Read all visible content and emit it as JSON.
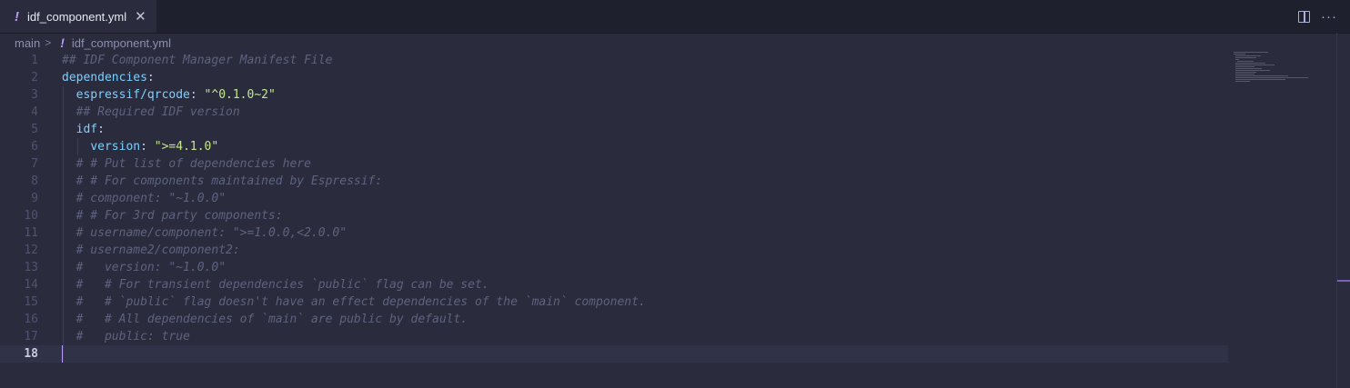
{
  "tab": {
    "label": "idf_component.yml",
    "close": "✕",
    "modified_icon": "!"
  },
  "toolbar": {
    "split_icon": "split-editor-icon",
    "more": "···"
  },
  "breadcrumb": {
    "folder": "main",
    "separator": ">",
    "file": "idf_component.yml"
  },
  "editor": {
    "current_line": 18,
    "lines": [
      {
        "n": "1",
        "parts": [
          {
            "t": "## IDF Component Manager Manifest File",
            "c": "comment"
          }
        ]
      },
      {
        "n": "2",
        "parts": [
          {
            "t": "dependencies",
            "c": "key"
          },
          {
            "t": ":",
            "c": "punct"
          }
        ]
      },
      {
        "n": "3",
        "parts": [
          {
            "t": "  "
          },
          {
            "t": "espressif/qrcode",
            "c": "key"
          },
          {
            "t": ": ",
            "c": "punct"
          },
          {
            "t": "\"^0.1.0~2\"",
            "c": "str"
          }
        ]
      },
      {
        "n": "4",
        "parts": [
          {
            "t": "  "
          },
          {
            "t": "## Required IDF version",
            "c": "comment"
          }
        ]
      },
      {
        "n": "5",
        "parts": [
          {
            "t": "  "
          },
          {
            "t": "idf",
            "c": "key"
          },
          {
            "t": ":",
            "c": "punct"
          }
        ]
      },
      {
        "n": "6",
        "parts": [
          {
            "t": "    "
          },
          {
            "t": "version",
            "c": "key"
          },
          {
            "t": ": ",
            "c": "punct"
          },
          {
            "t": "\">=4.1.0\"",
            "c": "str"
          }
        ]
      },
      {
        "n": "7",
        "parts": [
          {
            "t": "  "
          },
          {
            "t": "# # Put list of dependencies here",
            "c": "comment"
          }
        ]
      },
      {
        "n": "8",
        "parts": [
          {
            "t": "  "
          },
          {
            "t": "# # For components maintained by Espressif:",
            "c": "comment"
          }
        ]
      },
      {
        "n": "9",
        "parts": [
          {
            "t": "  "
          },
          {
            "t": "# component: \"~1.0.0\"",
            "c": "comment"
          }
        ]
      },
      {
        "n": "10",
        "parts": [
          {
            "t": "  "
          },
          {
            "t": "# # For 3rd party components:",
            "c": "comment"
          }
        ]
      },
      {
        "n": "11",
        "parts": [
          {
            "t": "  "
          },
          {
            "t": "# username/component: \">=1.0.0,<2.0.0\"",
            "c": "comment"
          }
        ]
      },
      {
        "n": "12",
        "parts": [
          {
            "t": "  "
          },
          {
            "t": "# username2/component2:",
            "c": "comment"
          }
        ]
      },
      {
        "n": "13",
        "parts": [
          {
            "t": "  "
          },
          {
            "t": "#   version: \"~1.0.0\"",
            "c": "comment"
          }
        ]
      },
      {
        "n": "14",
        "parts": [
          {
            "t": "  "
          },
          {
            "t": "#   # For transient dependencies `public` flag can be set.",
            "c": "comment"
          }
        ]
      },
      {
        "n": "15",
        "parts": [
          {
            "t": "  "
          },
          {
            "t": "#   # `public` flag doesn't have an effect dependencies of the `main` component.",
            "c": "comment"
          }
        ]
      },
      {
        "n": "16",
        "parts": [
          {
            "t": "  "
          },
          {
            "t": "#   # All dependencies of `main` are public by default.",
            "c": "comment"
          }
        ]
      },
      {
        "n": "17",
        "parts": [
          {
            "t": "  "
          },
          {
            "t": "#   public: true",
            "c": "comment"
          }
        ]
      },
      {
        "n": "18",
        "parts": []
      }
    ]
  },
  "colors": {
    "accent": "#bb9af7",
    "background": "#2a2b3d",
    "key": "#7dcfff",
    "string": "#c3e88d",
    "comment": "#5d637f"
  }
}
